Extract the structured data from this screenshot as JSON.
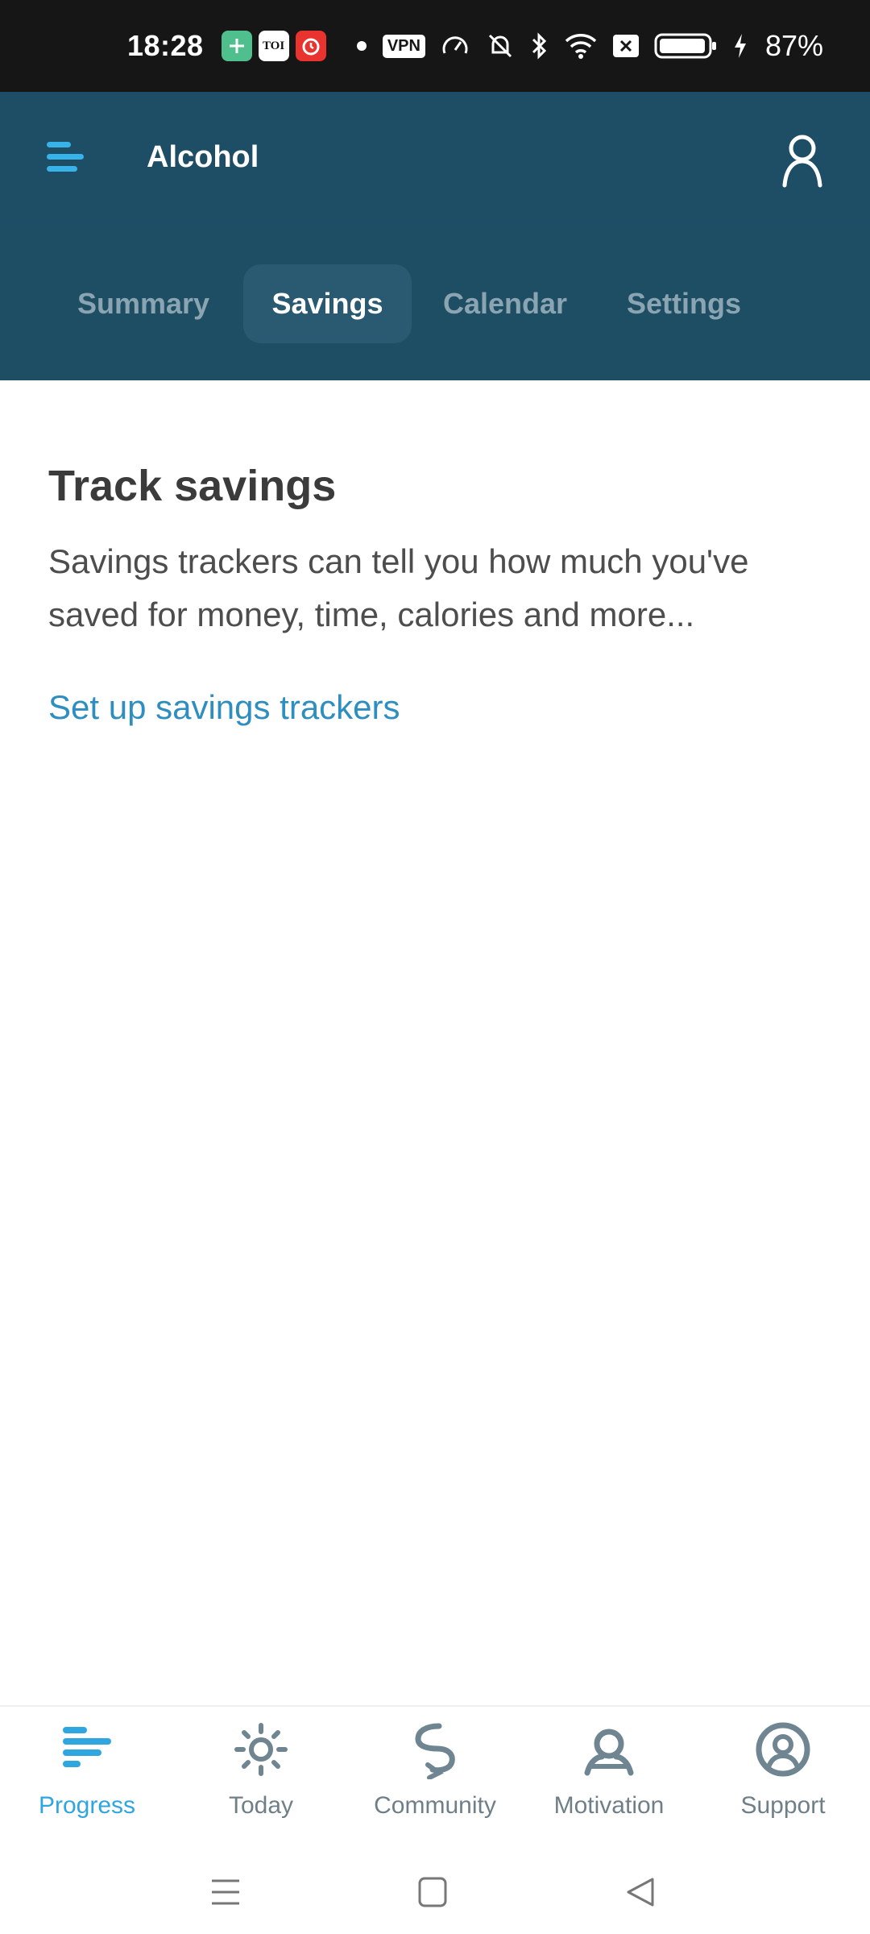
{
  "status_bar": {
    "time": "18:28",
    "notif_icons": [
      "app-green-icon",
      "toi-icon",
      "alarm-red-icon"
    ],
    "toi_text": "TOI",
    "vpn_label": "VPN",
    "battery_percent": "87%"
  },
  "header": {
    "title": "Alcohol",
    "menu_icon": "hamburger-menu-icon",
    "profile_icon": "person-icon"
  },
  "tabs": [
    {
      "label": "Summary",
      "active": false
    },
    {
      "label": "Savings",
      "active": true
    },
    {
      "label": "Calendar",
      "active": false
    },
    {
      "label": "Settings",
      "active": false
    }
  ],
  "main": {
    "heading": "Track savings",
    "description": "Savings trackers can tell you how much you've saved for money, time, calories and more...",
    "link_label": "Set up savings trackers"
  },
  "bottom_nav": [
    {
      "label": "Progress",
      "icon": "progress-bars-icon",
      "active": true
    },
    {
      "label": "Today",
      "icon": "sun-icon",
      "active": false
    },
    {
      "label": "Community",
      "icon": "community-icon",
      "active": false
    },
    {
      "label": "Motivation",
      "icon": "motivation-icon",
      "active": false
    },
    {
      "label": "Support",
      "icon": "lifebuoy-icon",
      "active": false
    }
  ],
  "colors": {
    "header_bg": "#1e4d66",
    "accent": "#2fa6df",
    "link": "#2e8ec0",
    "inactive_icon": "#6f8591"
  }
}
